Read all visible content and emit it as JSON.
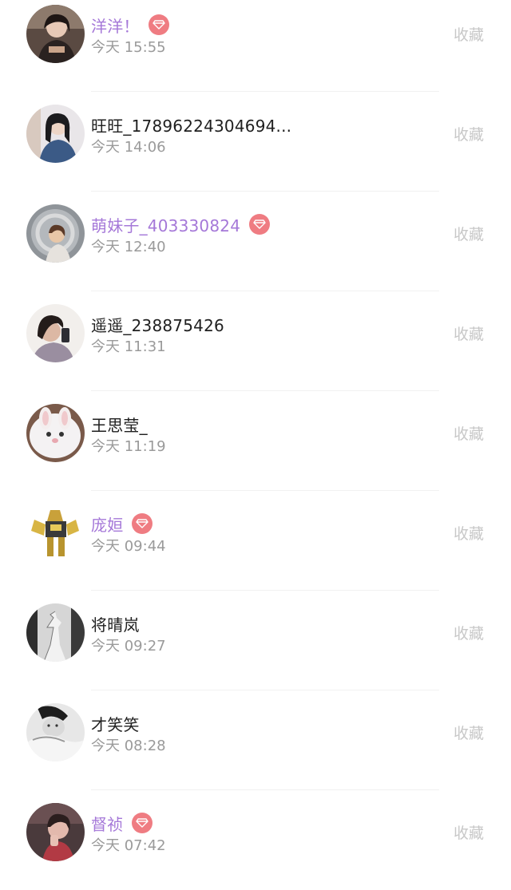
{
  "favorite_label": "收藏",
  "vip_color": "#a578d8",
  "badge_color": "#ef7c82",
  "users": [
    {
      "name": "洋洋！",
      "time": "今天 15:55",
      "vip": true
    },
    {
      "name": "旺旺_17896224304694...",
      "time": "今天 14:06",
      "vip": false
    },
    {
      "name": "萌妹子_403330824",
      "time": "今天 12:40",
      "vip": true
    },
    {
      "name": "遥遥_238875426",
      "time": "今天 11:31",
      "vip": false
    },
    {
      "name": "王思莹_",
      "time": "今天 11:19",
      "vip": false
    },
    {
      "name": "庞姮",
      "time": "今天 09:44",
      "vip": true
    },
    {
      "name": "将晴岚",
      "time": "今天 09:27",
      "vip": false
    },
    {
      "name": "才笑笑",
      "time": "今天 08:28",
      "vip": false
    },
    {
      "name": "督祯",
      "time": "今天 07:42",
      "vip": true
    }
  ]
}
